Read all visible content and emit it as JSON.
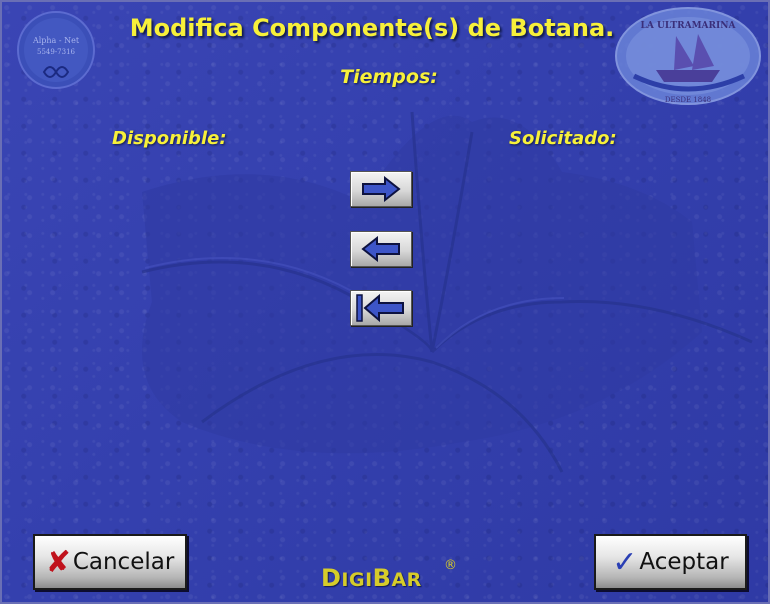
{
  "title": "Modifica Componente(s) de Botana.",
  "subtitle": "Tiempos:",
  "columns": {
    "available_label": "Disponible:",
    "requested_label": "Solicitado:"
  },
  "buttons": {
    "cancel": {
      "icon": "x-icon",
      "label": "Cancelar"
    },
    "accept": {
      "icon": "check-icon",
      "label": "Aceptar"
    },
    "move_right": {
      "icon": "arrow-right-icon"
    },
    "move_left": {
      "icon": "arrow-left-icon"
    },
    "move_all_left": {
      "icon": "arrow-left-bar-icon"
    }
  },
  "logos": {
    "left": {
      "line1": "Alpha - Net",
      "line2": "5549-7316"
    },
    "right": {
      "line1": "LA ULTRAMARINA",
      "line2": "DESDE 1848"
    }
  },
  "brand": {
    "D": "D",
    "igi": "IGI",
    "B": "B",
    "ar": "AR",
    "reg": "®"
  },
  "colors": {
    "background": "#3440ae",
    "title": "#f7f03a",
    "cancel_icon": "#c0121c",
    "accept_icon": "#2a3fb4"
  }
}
